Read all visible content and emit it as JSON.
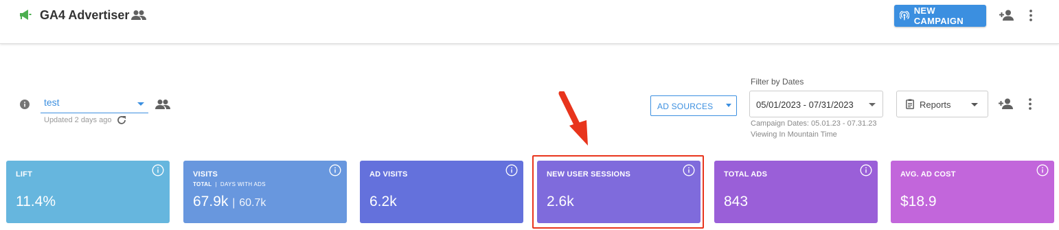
{
  "header": {
    "title": "GA4 Advertiser",
    "icons": [
      "megaphone-icon",
      "people-icon",
      "add-user-icon",
      "more-vert-icon"
    ],
    "new_campaign_label": "NEW CAMPAIGN"
  },
  "toolbar": {
    "campaign_select_value": "test",
    "updated_text": "Updated 2 days ago",
    "ad_sources_label": "AD SOURCES",
    "filter_label": "Filter by Dates",
    "date_range": "05/01/2023 - 07/31/2023",
    "campaign_dates": "Campaign Dates: 05.01.23 - 07.31.23",
    "viewing_tz": "Viewing In Mountain Time",
    "reports_label": "Reports"
  },
  "cards": [
    {
      "title": "LIFT",
      "value": "11.4%",
      "color": "#66b6de"
    },
    {
      "title": "VISITS",
      "sub_a": "TOTAL",
      "sub_sep": "|",
      "sub_b": "DAYS WITH ADS",
      "value": "67.9k",
      "value_sep": "|",
      "value_secondary": "60.7k",
      "color": "#6897de"
    },
    {
      "title": "AD VISITS",
      "value": "6.2k",
      "color": "#6471dc"
    },
    {
      "title": "NEW USER SESSIONS",
      "value": "2.6k",
      "color": "#7f6bdc"
    },
    {
      "title": "TOTAL ADS",
      "value": "843",
      "color": "#9a5fd8"
    },
    {
      "title": "AVG. AD COST",
      "value": "$18.9",
      "color": "#c266db"
    }
  ],
  "annotation": {
    "color": "#e8341c"
  }
}
